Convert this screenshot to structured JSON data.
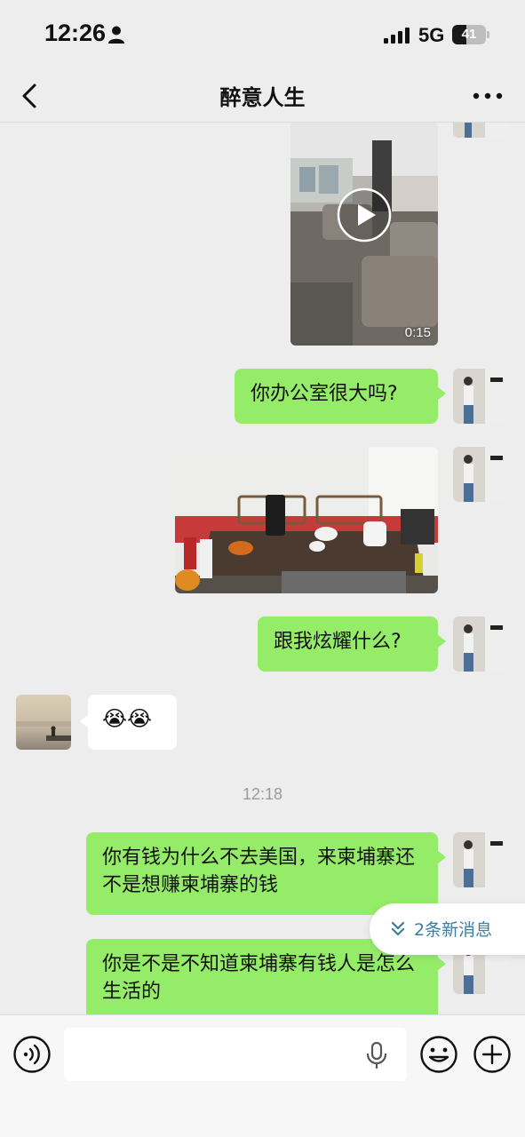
{
  "status_bar": {
    "time": "12:26",
    "network": "5G",
    "battery": "41",
    "battery_level": 0.41
  },
  "nav": {
    "title": "醉意人生",
    "back_icon": "chevron-left-icon",
    "more_icon": "more-horizontal-icon"
  },
  "messages": {
    "video_duration": "0:15",
    "m1": "你办公室很大吗?",
    "m2": "跟我炫耀什么?",
    "m3": "😭😭",
    "m4": "你有钱为什么不去美国，来柬埔寨还不是想赚柬埔寨的钱",
    "m5": "你是不是不知道柬埔寨有钱人是怎么生活的"
  },
  "timestamp": "12:18",
  "new_messages_pill": {
    "label": "2条新消息",
    "icon": "double-chevron-down-icon"
  },
  "input_bar": {
    "voice_icon": "voice-icon",
    "mic_icon": "mic-icon",
    "emoji_icon": "emoji-icon",
    "plus_icon": "plus-circle-icon"
  },
  "colors": {
    "bubble_me": "#95ec69",
    "bubble_them": "#ffffff",
    "background": "#ededed",
    "link": "#3b7ea1"
  }
}
